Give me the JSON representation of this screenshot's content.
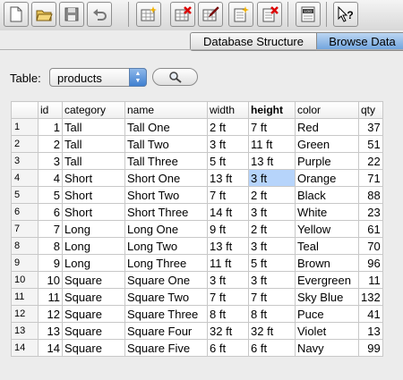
{
  "toolbar": {
    "buttons": [
      {
        "name": "new-database-icon"
      },
      {
        "name": "open-database-icon"
      },
      {
        "name": "save-database-icon"
      },
      {
        "name": "undo-icon"
      },
      {
        "name": "create-table-icon"
      },
      {
        "name": "delete-table-icon"
      },
      {
        "name": "modify-table-icon"
      },
      {
        "name": "create-index-icon"
      },
      {
        "name": "delete-index-icon"
      },
      {
        "name": "sql-log-icon"
      },
      {
        "name": "whats-this-help-icon"
      }
    ]
  },
  "tabs": {
    "database_structure": "Database Structure",
    "browse_data": "Browse Data",
    "active": "Browse Data"
  },
  "selector": {
    "label": "Table:",
    "selected_table": "products"
  },
  "grid": {
    "columns": [
      "id",
      "category",
      "name",
      "width",
      "height",
      "color",
      "qty"
    ],
    "sorted_column": "height",
    "selected_cell": {
      "row": 4,
      "column": "height"
    },
    "rows": [
      [
        "1",
        "1",
        "Tall",
        "Tall One",
        "2 ft",
        "7 ft",
        "Red",
        "37"
      ],
      [
        "2",
        "2",
        "Tall",
        "Tall Two",
        "3 ft",
        "11 ft",
        "Green",
        "51"
      ],
      [
        "3",
        "3",
        "Tall",
        "Tall Three",
        "5 ft",
        "13 ft",
        "Purple",
        "22"
      ],
      [
        "4",
        "4",
        "Short",
        "Short One",
        "13 ft",
        "3 ft",
        "Orange",
        "71"
      ],
      [
        "5",
        "5",
        "Short",
        "Short Two",
        "7 ft",
        "2 ft",
        "Black",
        "88"
      ],
      [
        "6",
        "6",
        "Short",
        "Short Three",
        "14 ft",
        "3 ft",
        "White",
        "23"
      ],
      [
        "7",
        "7",
        "Long",
        "Long One",
        "9 ft",
        "2 ft",
        "Yellow",
        "61"
      ],
      [
        "8",
        "8",
        "Long",
        "Long Two",
        "13 ft",
        "3 ft",
        "Teal",
        "70"
      ],
      [
        "9",
        "9",
        "Long",
        "Long Three",
        "11 ft",
        "5 ft",
        "Brown",
        "96"
      ],
      [
        "10",
        "10",
        "Square",
        "Square One",
        "3 ft",
        "3 ft",
        "Evergreen",
        "11"
      ],
      [
        "11",
        "11",
        "Square",
        "Square Two",
        "7 ft",
        "7 ft",
        "Sky Blue",
        "132"
      ],
      [
        "12",
        "12",
        "Square",
        "Square Three",
        "8 ft",
        "8 ft",
        "Puce",
        "41"
      ],
      [
        "13",
        "13",
        "Square",
        "Square Four",
        "32 ft",
        "32 ft",
        "Violet",
        "13"
      ],
      [
        "14",
        "14",
        "Square",
        "Square Five",
        "6 ft",
        "6 ft",
        "Navy",
        "99"
      ]
    ]
  },
  "colors": {
    "tab_active": "#6fa3dd",
    "selected_cell": "#b6d4fb",
    "grid_line": "#c8c8c8"
  }
}
